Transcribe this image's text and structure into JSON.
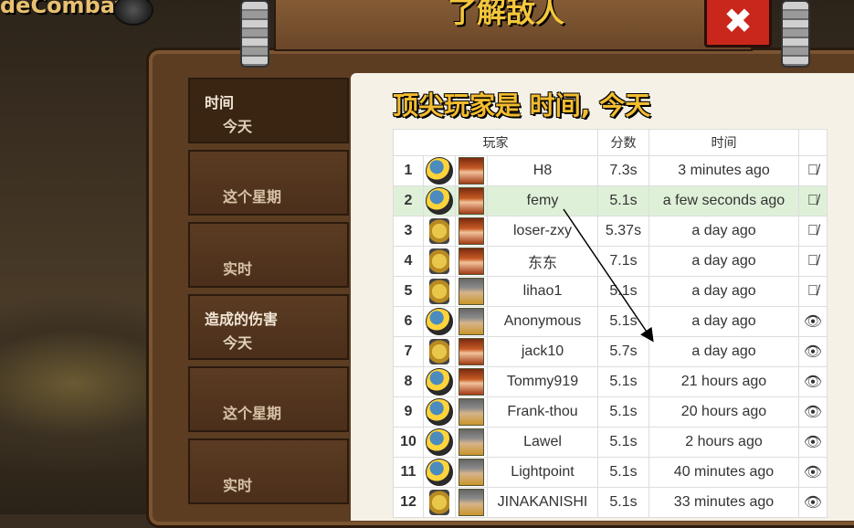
{
  "app": {
    "brand": "deCombat"
  },
  "modal": {
    "title": "了解敌人",
    "close_label": "✖"
  },
  "sidebar": {
    "sections": [
      {
        "label": "时间",
        "sub": "今天"
      },
      {
        "label": "这个星期"
      },
      {
        "label": "实时"
      },
      {
        "label": "造成的伤害",
        "sub": "今天"
      },
      {
        "label": "这个星期"
      },
      {
        "label": "实时"
      }
    ]
  },
  "leaderboard": {
    "heading": "顶尖玩家是 时间, 今天",
    "columns": {
      "player": "玩家",
      "score": "分数",
      "time": "时间"
    },
    "rows": [
      {
        "rank": "1",
        "lang": "python",
        "hero": "red",
        "name": "H8",
        "score": "7.3s",
        "time": "3 minutes ago",
        "watch": "eye-slash-icon"
      },
      {
        "rank": "2",
        "lang": "python",
        "hero": "red",
        "name": "femy",
        "score": "5.1s",
        "time": "a few seconds ago",
        "watch": "eye-slash-icon",
        "highlight": true
      },
      {
        "rank": "3",
        "lang": "javascript",
        "hero": "red",
        "name": "loser-zxy",
        "score": "5.37s",
        "time": "a day ago",
        "watch": "eye-slash-icon"
      },
      {
        "rank": "4",
        "lang": "javascript",
        "hero": "red",
        "name": "东东",
        "score": "7.1s",
        "time": "a day ago",
        "watch": "eye-slash-icon"
      },
      {
        "rank": "5",
        "lang": "javascript",
        "hero": "grey",
        "name": "lihao1",
        "score": "5.1s",
        "time": "a day ago",
        "watch": "eye-slash-icon"
      },
      {
        "rank": "6",
        "lang": "python",
        "hero": "grey",
        "name": "Anonymous",
        "score": "5.1s",
        "time": "a day ago",
        "watch": "eye-icon"
      },
      {
        "rank": "7",
        "lang": "javascript",
        "hero": "red",
        "name": "jack10",
        "score": "5.7s",
        "time": "a day ago",
        "watch": "eye-icon"
      },
      {
        "rank": "8",
        "lang": "python",
        "hero": "red",
        "name": "Tommy919",
        "score": "5.1s",
        "time": "21 hours ago",
        "watch": "eye-icon"
      },
      {
        "rank": "9",
        "lang": "python",
        "hero": "grey",
        "name": "Frank-thou",
        "score": "5.1s",
        "time": "20 hours ago",
        "watch": "eye-icon"
      },
      {
        "rank": "10",
        "lang": "python",
        "hero": "grey",
        "name": "Lawel",
        "score": "5.1s",
        "time": "2 hours ago",
        "watch": "eye-icon"
      },
      {
        "rank": "11",
        "lang": "python",
        "hero": "grey",
        "name": "Lightpoint",
        "score": "5.1s",
        "time": "40 minutes ago",
        "watch": "eye-icon"
      },
      {
        "rank": "12",
        "lang": "javascript",
        "hero": "grey",
        "name": "JINAKANISHI",
        "score": "5.1s",
        "time": "33 minutes ago",
        "watch": "eye-icon"
      }
    ]
  }
}
